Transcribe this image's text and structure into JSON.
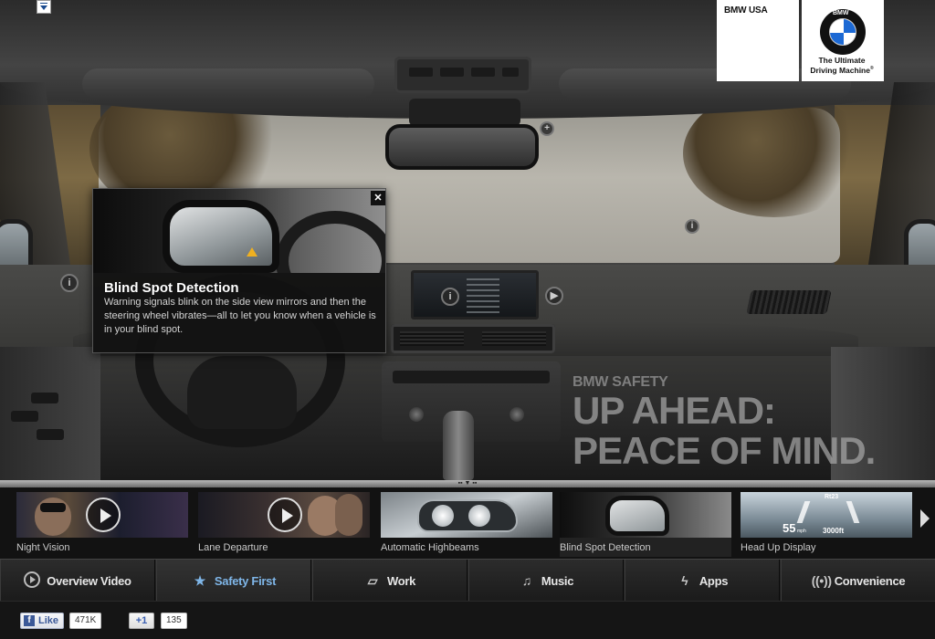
{
  "brand": {
    "region_label": "BMW USA",
    "roundel_letters": "BMW",
    "tagline_line1": "The Ultimate",
    "tagline_line2": "Driving Machine",
    "tagline_mark": "®",
    "colors": {
      "roundel_blue": "#1c69d4",
      "roundel_white": "#ffffff",
      "roundel_ring": "#111111"
    }
  },
  "popup": {
    "title": "Blind Spot Detection",
    "body": "Warning signals blink on the side view mirrors and then the steering wheel vibrates—all to let you know when a vehicle is in your blind spot.",
    "close_icon": "close-icon",
    "close_glyph": "✕"
  },
  "hotspots": {
    "info_glyph": "i",
    "plus_glyph": "+",
    "play_icon": "play-circle-icon"
  },
  "headline": {
    "kicker": "BMW SAFETY",
    "line1": "UP AHEAD:",
    "line2": "PEACE OF MIND."
  },
  "carousel": {
    "items": [
      {
        "label": "Night Vision",
        "has_play": true
      },
      {
        "label": "Lane Departure",
        "has_play": true
      },
      {
        "label": "Automatic Highbeams",
        "has_play": false
      },
      {
        "label": "Blind Spot Detection",
        "has_play": false
      },
      {
        "label": "Head Up Display",
        "has_play": false
      }
    ],
    "hud": {
      "road": "Rt23",
      "speed": "55",
      "unit": "mph",
      "distance": "3000ft"
    },
    "next_icon": "chevron-right-icon"
  },
  "nav": {
    "items": [
      {
        "label": "Overview Video",
        "icon": "play-circle-icon"
      },
      {
        "label": "Safety First",
        "icon": "star-icon",
        "active": true
      },
      {
        "label": "Work",
        "icon": "book-icon"
      },
      {
        "label": "Music",
        "icon": "music-icon"
      },
      {
        "label": "Apps",
        "icon": "lightning-icon"
      },
      {
        "label": "Convenience",
        "icon": "signal-icon"
      }
    ],
    "active_color": "#3d8fd6"
  },
  "footer": {
    "fb_like_label": "Like",
    "fb_like_count": "471K",
    "gplus_label": "+1",
    "gplus_count": "135"
  }
}
